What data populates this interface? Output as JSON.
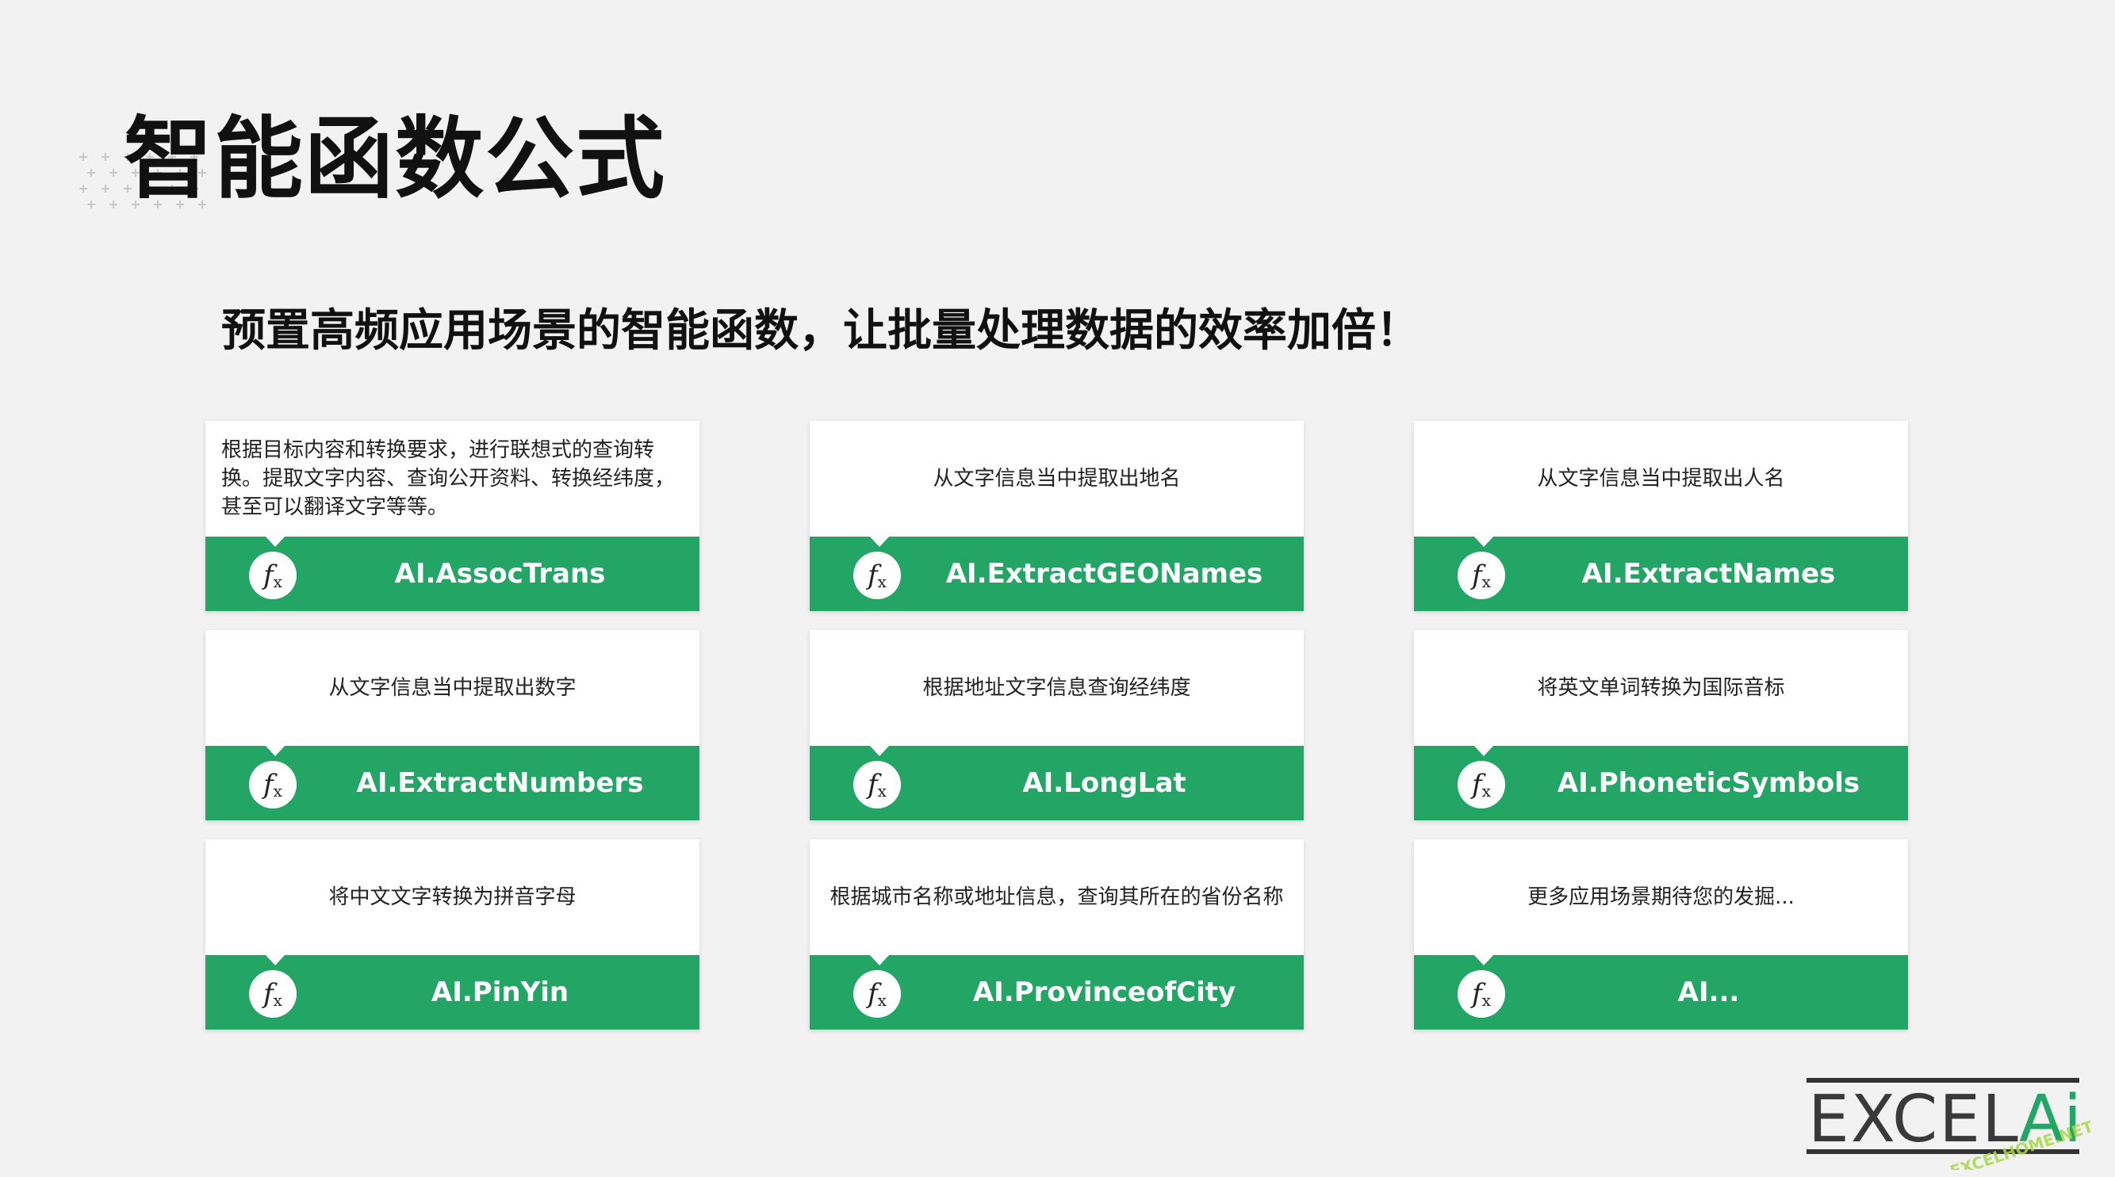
{
  "title": "智能函数公式",
  "subtitle": "预置高频应用场景的智能函数，让批量处理数据的效率加倍！",
  "accent_color": "#22a565",
  "fx_icon": "fx-icon",
  "cards": [
    {
      "desc": "根据目标内容和转换要求，进行联想式的查询转换。提取文字内容、查询公开资料、转换经纬度，甚至可以翻译文字等等。",
      "name": "AI.AssocTrans"
    },
    {
      "desc": "从文字信息当中提取出地名",
      "name": "AI.ExtractGEONames"
    },
    {
      "desc": "从文字信息当中提取出人名",
      "name": "AI.ExtractNames"
    },
    {
      "desc": "从文字信息当中提取出数字",
      "name": "AI.ExtractNumbers"
    },
    {
      "desc": "根据地址文字信息查询经纬度",
      "name": "AI.LongLat"
    },
    {
      "desc": "将英文单词转换为国际音标",
      "name": "AI.PhoneticSymbols"
    },
    {
      "desc": "将中文文字转换为拼音字母",
      "name": "AI.PinYin"
    },
    {
      "desc": "根据城市名称或地址信息，查询其所在的省份名称",
      "name": "AI.ProvinceofCity"
    },
    {
      "desc": "更多应用场景期待您的发掘...",
      "name": "AI..."
    }
  ],
  "logo": {
    "text_main": "EXCELAi",
    "text_watermark": "EXCELHOME.NET"
  }
}
